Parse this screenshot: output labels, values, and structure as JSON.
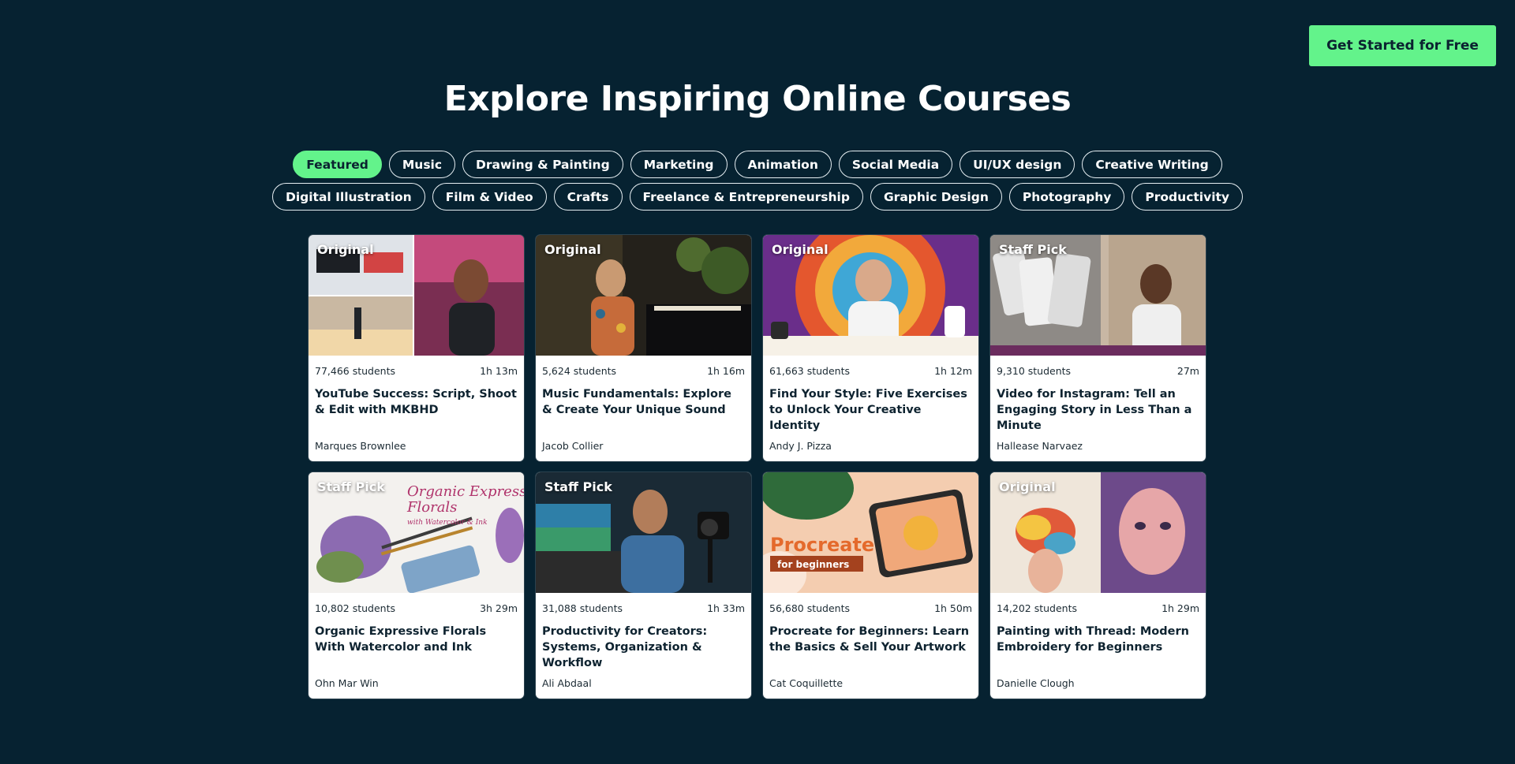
{
  "cta": {
    "label": "Get Started for Free"
  },
  "page_title": "Explore Inspiring Online Courses",
  "tabs_row1": [
    "Featured",
    "Music",
    "Drawing & Painting",
    "Marketing",
    "Animation",
    "Social Media",
    "UI/UX design",
    "Creative Writing"
  ],
  "tabs_row2": [
    "Digital Illustration",
    "Film & Video",
    "Crafts",
    "Freelance & Entrepreneurship",
    "Graphic Design",
    "Photography",
    "Productivity"
  ],
  "active_tab": "Featured",
  "colors": {
    "background": "#062231",
    "accent": "#63f38b"
  },
  "courses": [
    {
      "badge": "Original",
      "students": "77,466 students",
      "duration": "1h 13m",
      "title": "YouTube Success: Script, Shoot & Edit with MKBHD",
      "author": "Marques Brownlee"
    },
    {
      "badge": "Original",
      "students": "5,624 students",
      "duration": "1h 16m",
      "title": "Music Fundamentals: Explore & Create Your Unique Sound",
      "author": "Jacob Collier"
    },
    {
      "badge": "Original",
      "students": "61,663 students",
      "duration": "1h 12m",
      "title": "Find Your Style: Five Exercises to Unlock Your Creative Identity",
      "author": "Andy J. Pizza"
    },
    {
      "badge": "Staff Pick",
      "students": "9,310 students",
      "duration": "27m",
      "title": "Video for Instagram: Tell an Engaging Story in Less Than a Minute",
      "author": "Hallease Narvaez"
    },
    {
      "badge": "Staff Pick",
      "students": "10,802 students",
      "duration": "3h 29m",
      "title": "Organic Expressive Florals With Watercolor and Ink",
      "author": "Ohn Mar Win",
      "thumb_text": [
        "Organic Expressive",
        "Florals",
        "with Watercolor & Ink"
      ]
    },
    {
      "badge": "Staff Pick",
      "students": "31,088 students",
      "duration": "1h 33m",
      "title": "Productivity for Creators: Systems, Organization & Workflow",
      "author": "Ali Abdaal"
    },
    {
      "badge": "",
      "students": "56,680 students",
      "duration": "1h 50m",
      "title": "Procreate for Beginners: Learn the Basics & Sell Your Artwork",
      "author": "Cat Coquillette",
      "thumb_text": [
        "Procreate",
        "for beginners"
      ]
    },
    {
      "badge": "Original",
      "students": "14,202 students",
      "duration": "1h 29m",
      "title": "Painting with Thread: Modern Embroidery for Beginners",
      "author": "Danielle Clough"
    }
  ]
}
